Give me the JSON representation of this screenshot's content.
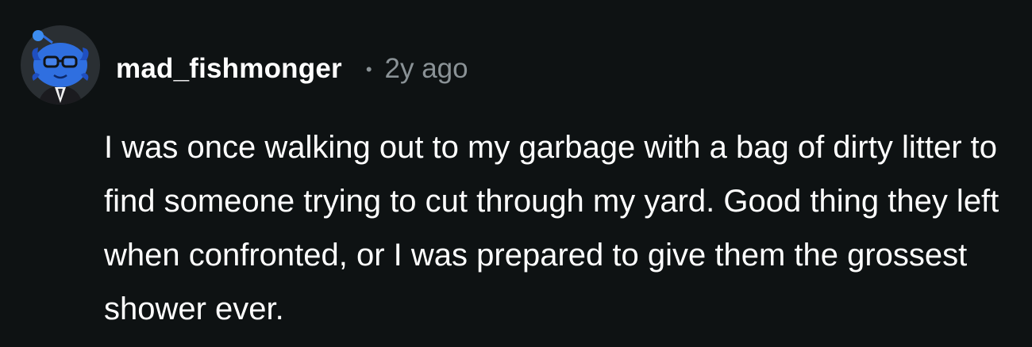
{
  "comment": {
    "username": "mad_fishmonger",
    "separator": "•",
    "timestamp": "2y ago",
    "text": "I was once walking out to my garbage with a bag of dirty litter to find someone trying to cut through my yard. Good thing they left when confronted, or I was prepared to give them the grossest shower ever.",
    "avatar_icon": "snoo-avatar-icon"
  },
  "colors": {
    "background": "#0e1213",
    "username": "#ffffff",
    "meta": "#8a9296",
    "body": "#ffffff",
    "avatar_blue": "#2f6fe0"
  }
}
